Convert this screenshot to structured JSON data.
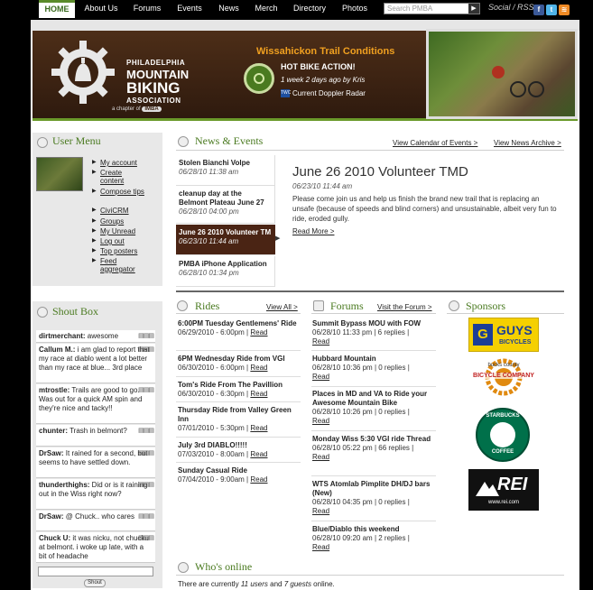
{
  "nav": {
    "items": [
      "HOME",
      "About Us",
      "Forums",
      "Events",
      "News",
      "Merch",
      "Directory",
      "Photos"
    ],
    "search_placeholder": "Search PMBA",
    "social_label": "Social / RSS"
  },
  "banner": {
    "org_line1": "PHILADELPHIA",
    "org_line2": "MOUNTAIN",
    "org_line3": "BIKING",
    "org_line4": "ASSOCIATION",
    "chapter": "a chapter of",
    "chapter_org": "IMBA",
    "trail_title": "Wissahickon Trail Conditions",
    "trail_status": "HOT BIKE ACTION!",
    "trail_meta": "1 week 2 days ago by Kris",
    "radar_badge": "TWC",
    "radar": "Current Doppler Radar"
  },
  "user_menu": {
    "title": "User Menu",
    "items": [
      "My account",
      "Create content",
      "Compose tips",
      "CiviCRM",
      "Groups",
      "My Unread",
      "Log out",
      "Top posters",
      "Feed aggregator"
    ]
  },
  "shoutbox": {
    "title": "Shout Box",
    "shouts": [
      {
        "user": "dirtmerchant:",
        "text": "awesome"
      },
      {
        "user": "Callum M.:",
        "text": "i am glad to report that my race at diablo went a lot better than my race at blue... 3rd place"
      },
      {
        "user": "mtrostle:",
        "text": "Trails are good to go. Was out for a quick AM spin and they're nice and tacky!!"
      },
      {
        "user": "chunter:",
        "text": "Trash in belmont?"
      },
      {
        "user": "DrSaw:",
        "text": "It rained for a second, but seems to have settled down."
      },
      {
        "user": "thunderthighs:",
        "text": "Did or is it raining out in the Wiss right now?"
      },
      {
        "user": "DrSaw:",
        "text": "@ Chuck.. who cares"
      },
      {
        "user": "Chuck U:",
        "text": "it was nicku, not chucku at belmont. i woke up late, with a bit of headache"
      }
    ],
    "button": "Shout"
  },
  "news": {
    "title": "News & Events",
    "calendar_link": "View Calendar of Events >",
    "archive_link": "View News Archive >",
    "tabs": [
      {
        "title": "Stolen Bianchi Volpe",
        "date": "06/28/10 11:38 am"
      },
      {
        "title": "cleanup day at the Belmont Plateau June 27",
        "date": "06/28/10 04:00 pm"
      },
      {
        "title": "June 26 2010 Volunteer TM",
        "date": "06/23/10 11:44 am"
      },
      {
        "title": "PMBA iPhone Application",
        "date": "06/28/10 01:34 pm"
      }
    ],
    "feature": {
      "title": "June 26 2010 Volunteer TMD",
      "date": "06/23/10 11:44 am",
      "body": "Please come join us and help us finish the brand new trail that is replacing an unsafe (because of speeds and blind corners) and unsustainable, albeit very fun to ride, eroded gully.",
      "more": "Read More >"
    }
  },
  "rides": {
    "title": "Rides",
    "view_all": "View All >",
    "items": [
      {
        "title": "6:00PM Tuesday Gentlemens' Ride",
        "meta": "06/29/2010 - 6:00pm |",
        "read": "Read"
      },
      {
        "title": "6PM Wednesday Ride from VGI",
        "meta": "06/30/2010 - 6:00pm |",
        "read": "Read"
      },
      {
        "title": "Tom's Ride From The Pavillion",
        "meta": "06/30/2010 - 6:30pm |",
        "read": "Read"
      },
      {
        "title": "Thursday Ride from Valley Green Inn",
        "meta": "07/01/2010 - 5:30pm |",
        "read": "Read"
      },
      {
        "title": "July 3rd DIABLO!!!!!",
        "meta": "07/03/2010 - 8:00am |",
        "read": "Read"
      },
      {
        "title": "Sunday Casual Ride",
        "meta": "07/04/2010 - 9:00am |",
        "read": "Read"
      }
    ]
  },
  "forums": {
    "title": "Forums",
    "visit_link": "Visit the Forum >",
    "items": [
      {
        "title": "Summit Bypass MOU with FOW",
        "meta": "06/28/10 11:33 pm | 6 replies |",
        "read": "Read"
      },
      {
        "title": "Hubbard Mountain",
        "meta": "06/28/10 10:36 pm | 0 replies |",
        "read": "Read"
      },
      {
        "title": "Places in MD and VA to Ride your Awesome Mountain Bike",
        "meta": "06/28/10 10:26 pm | 0 replies |",
        "read": "Read"
      },
      {
        "title": "Monday Wiss 5:30 VGI ride Thread",
        "meta": "06/28/10 05:22 pm | 66 replies |",
        "read": "Read"
      },
      {
        "title": "WTS Atomlab Pimplite DH/DJ bars (New)",
        "meta": "06/28/10 04:35 pm | 0 replies |",
        "read": "Read"
      },
      {
        "title": "Blue/Diablo this weekend",
        "meta": "06/28/10 09:20 am | 2 replies |",
        "read": "Read"
      }
    ]
  },
  "sponsors": {
    "title": "Sponsors",
    "list": [
      {
        "line1": "GUYS",
        "line2": "BICYCLES"
      },
      {
        "line1": "bucks county",
        "line2": "BICYCLE COMPANY"
      },
      {
        "line1": "STARBUCKS",
        "line2": "COFFEE"
      },
      {
        "line1": "REI",
        "line2": "www.rei.com"
      }
    ]
  },
  "online": {
    "title": "Who's online",
    "text_pre": "There are currently ",
    "users": "11 users",
    "text_mid": " and ",
    "guests": "7 guests",
    "text_post": " online."
  },
  "colors": {
    "accent_green": "#4a7a20",
    "banner_brown": "#3b2212",
    "active_tab": "#4a2414"
  }
}
